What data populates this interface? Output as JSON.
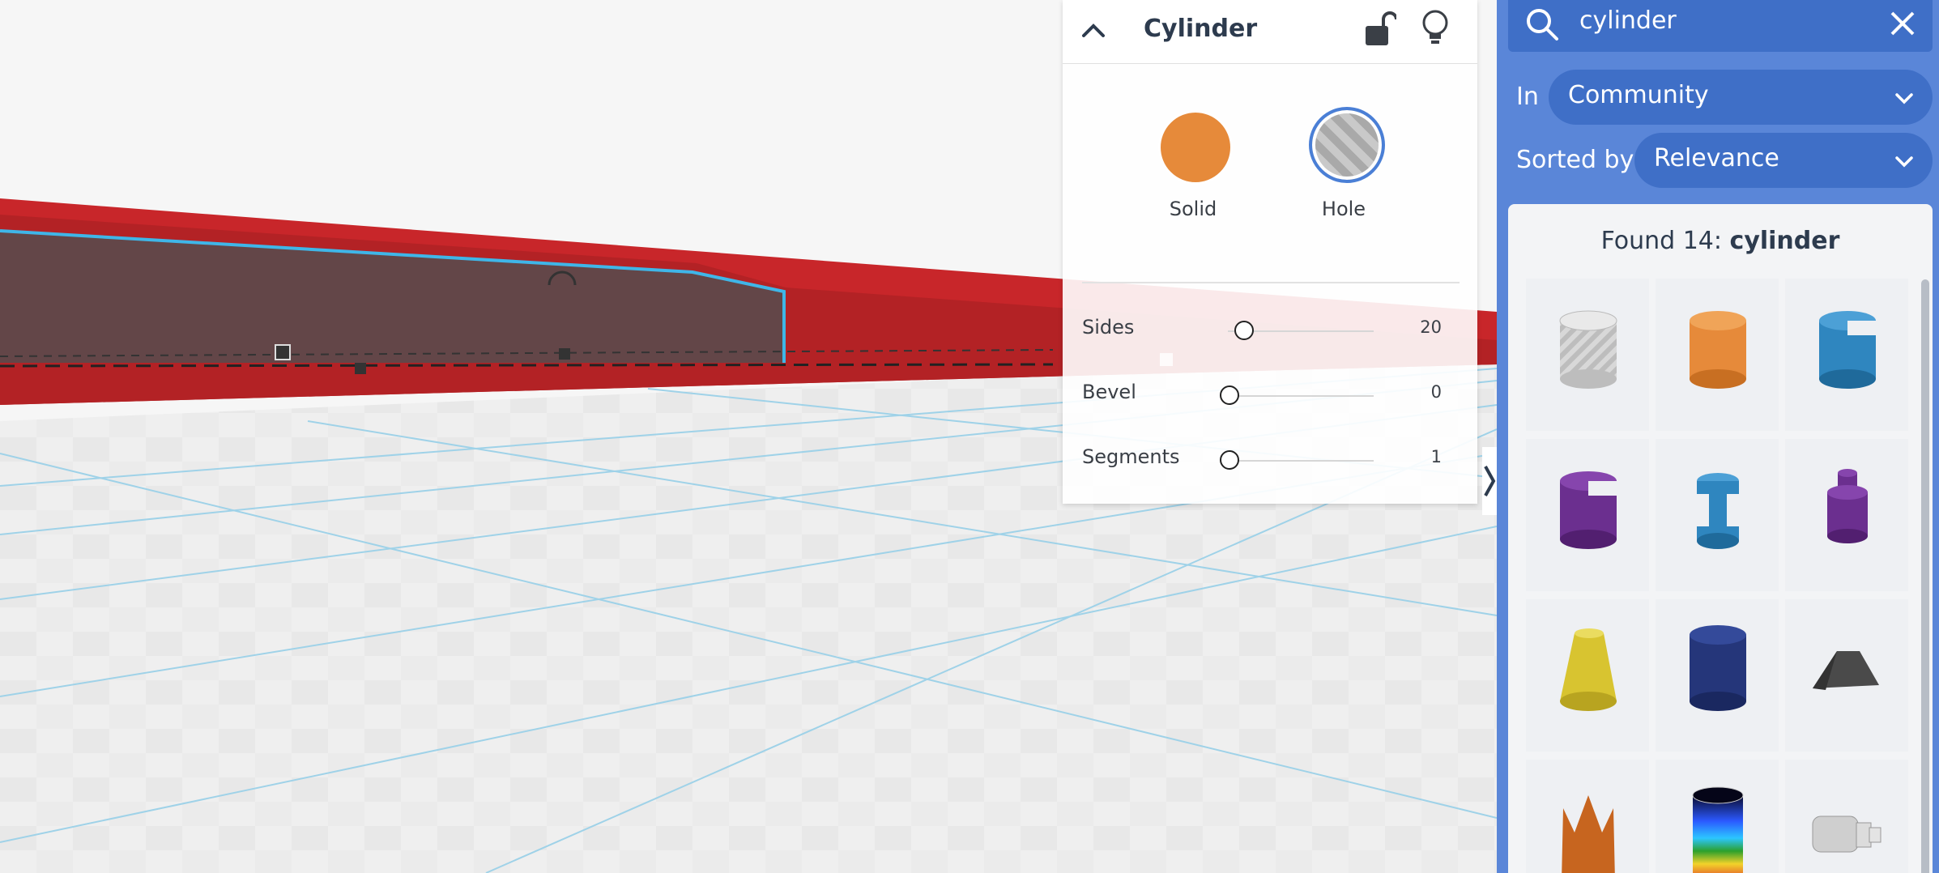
{
  "inspector": {
    "title": "Cylinder",
    "solid_label": "Solid",
    "hole_label": "Hole",
    "solid_color": "#e68a3a",
    "params": [
      {
        "label": "Sides",
        "value": "20",
        "level": 0.1
      },
      {
        "label": "Bevel",
        "value": "0",
        "level": 0.0
      },
      {
        "label": "Segments",
        "value": "1",
        "level": 0.0
      }
    ],
    "icons": [
      "chevron-up-icon",
      "lock-open-icon",
      "lightbulb-icon"
    ]
  },
  "library": {
    "search_value": "cylinder",
    "in_label": "In",
    "in_value": "Community",
    "sort_label": "Sorted by",
    "sort_value": "Relevance",
    "found_prefix": "Found 14: ",
    "found_term": "cylinder",
    "accent": "#5a86d8"
  },
  "shapes": [
    {
      "name": "striped-cylinder",
      "color": "#c8c8c8"
    },
    {
      "name": "orange-cylinder",
      "color": "#e68a3a"
    },
    {
      "name": "blue-notched-cylinder",
      "color": "#2f86bf"
    },
    {
      "name": "purple-notched-cylinder",
      "color": "#6b2f8f"
    },
    {
      "name": "blue-spool",
      "color": "#2f86bf"
    },
    {
      "name": "purple-knob",
      "color": "#6b2f8f"
    },
    {
      "name": "yellow-cone",
      "color": "#d8c430"
    },
    {
      "name": "navy-cylinder",
      "color": "#25367a"
    },
    {
      "name": "dark-pyramid",
      "color": "#4a4a4a"
    },
    {
      "name": "orange-crown",
      "color": "#c7651f"
    },
    {
      "name": "rainbow-cylinder",
      "color": "#2ca02c"
    },
    {
      "name": "grey-fitting",
      "color": "#cfcfcf"
    }
  ]
}
